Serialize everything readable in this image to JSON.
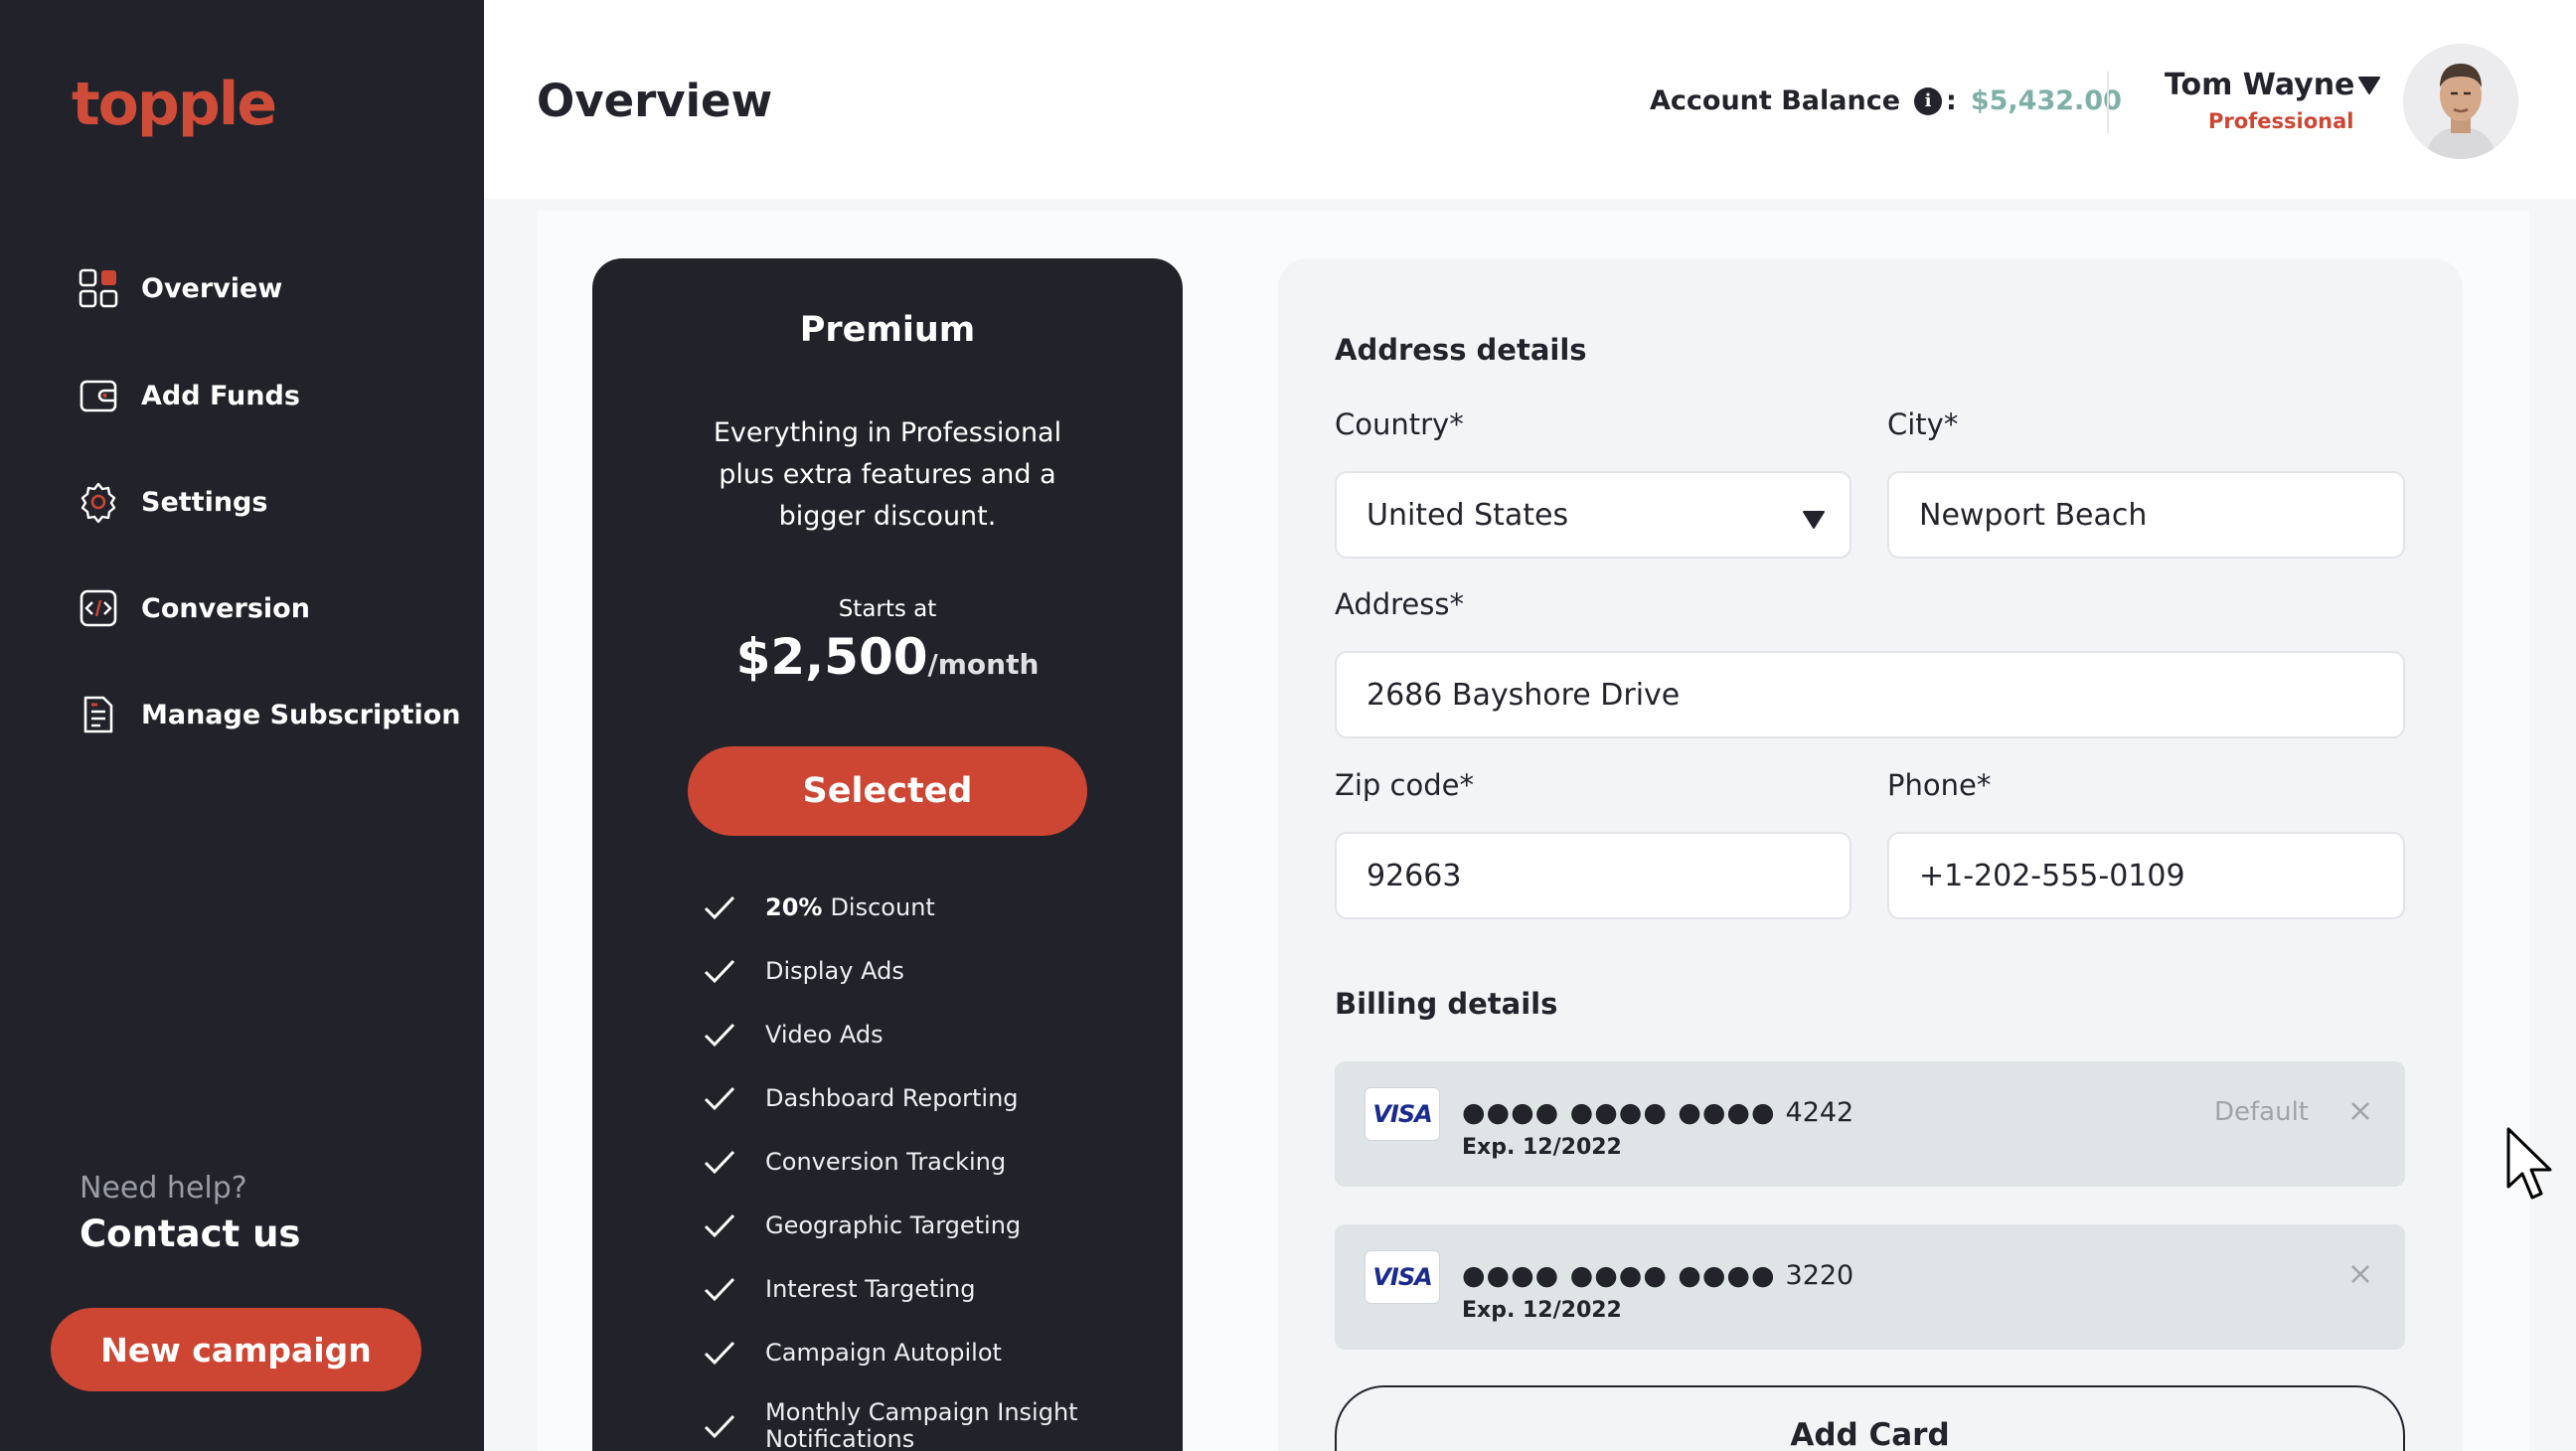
{
  "brand": {
    "logo": "topple",
    "accent": "#cd4634",
    "sidebar_bg": "#21222a"
  },
  "sidebar": {
    "items": [
      {
        "label": "Overview",
        "icon": "grid-icon"
      },
      {
        "label": "Add Funds",
        "icon": "wallet-icon"
      },
      {
        "label": "Settings",
        "icon": "gear-icon"
      },
      {
        "label": "Conversion",
        "icon": "code-icon"
      },
      {
        "label": "Manage Subscription",
        "icon": "document-icon"
      }
    ],
    "help_text": "Need help?",
    "contact_label": "Contact us",
    "new_campaign_label": "New campaign"
  },
  "header": {
    "title": "Overview",
    "balance_label": "Account Balance",
    "balance_info_glyph": "i",
    "balance_colon": ":",
    "balance_value": "$5,432.00",
    "user_name": "Tom Wayne",
    "user_plan": "Professional"
  },
  "plan": {
    "name": "Premium",
    "description": "Everything in Professional plus extra features and a bigger discount.",
    "starts_label": "Starts at",
    "price": "$2,500",
    "period": "/month",
    "button_label": "Selected",
    "discount_value": "20%",
    "features": [
      "Discount",
      "Display Ads",
      "Video Ads",
      "Dashboard Reporting",
      "Conversion Tracking",
      "Geographic Targeting",
      "Interest Targeting",
      "Campaign Autopilot",
      "Monthly Campaign Insight Notifications"
    ]
  },
  "address": {
    "title": "Address details",
    "country_label": "Country*",
    "country_value": "United States",
    "city_label": "City*",
    "city_value": "Newport Beach",
    "address_label": "Address*",
    "address_value": "2686 Bayshore Drive",
    "zip_label": "Zip code*",
    "zip_value": "92663",
    "phone_label": "Phone*",
    "phone_value": "+1-202-555-0109"
  },
  "billing": {
    "title": "Billing details",
    "cards": [
      {
        "brand": "VISA",
        "masked": "●●●● ●●●● ●●●●",
        "last4": "4242",
        "exp": "Exp. 12/2022",
        "tag": "Default"
      },
      {
        "brand": "VISA",
        "masked": "●●●● ●●●● ●●●●",
        "last4": "3220",
        "exp": "Exp. 12/2022",
        "tag": ""
      }
    ],
    "add_card_label": "Add Card"
  }
}
